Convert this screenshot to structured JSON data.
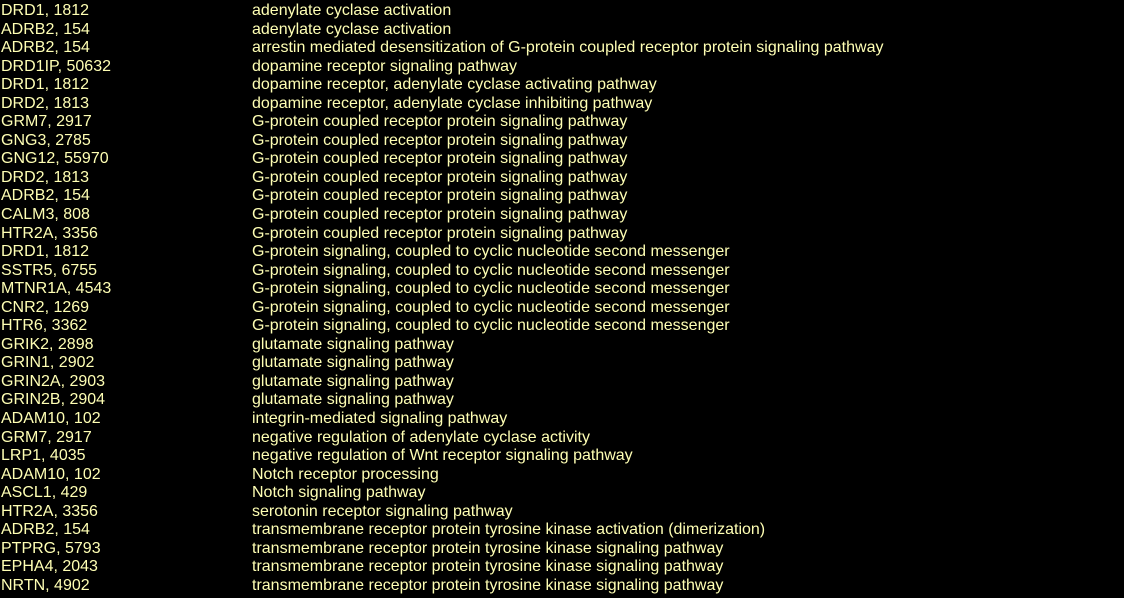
{
  "text_color": "#ffffb4",
  "rows": [
    {
      "gene": "DRD1, 1812",
      "term": "adenylate cyclase activation"
    },
    {
      "gene": "ADRB2, 154",
      "term": "adenylate cyclase activation"
    },
    {
      "gene": "ADRB2, 154",
      "term": "arrestin mediated desensitization of G-protein coupled receptor protein signaling pathway"
    },
    {
      "gene": "DRD1IP, 50632",
      "term": "dopamine receptor signaling pathway"
    },
    {
      "gene": "DRD1, 1812",
      "term": "dopamine receptor, adenylate cyclase activating pathway"
    },
    {
      "gene": "DRD2, 1813",
      "term": "dopamine receptor, adenylate cyclase inhibiting pathway"
    },
    {
      "gene": "GRM7, 2917",
      "term": "G-protein coupled receptor protein signaling pathway"
    },
    {
      "gene": "GNG3, 2785",
      "term": "G-protein coupled receptor protein signaling pathway"
    },
    {
      "gene": "GNG12, 55970",
      "term": "G-protein coupled receptor protein signaling pathway"
    },
    {
      "gene": "DRD2, 1813",
      "term": "G-protein coupled receptor protein signaling pathway"
    },
    {
      "gene": "ADRB2, 154",
      "term": "G-protein coupled receptor protein signaling pathway"
    },
    {
      "gene": "CALM3, 808",
      "term": "G-protein coupled receptor protein signaling pathway"
    },
    {
      "gene": "HTR2A, 3356",
      "term": "G-protein coupled receptor protein signaling pathway"
    },
    {
      "gene": "DRD1, 1812",
      "term": "G-protein signaling, coupled to cyclic nucleotide second messenger"
    },
    {
      "gene": "SSTR5, 6755",
      "term": "G-protein signaling, coupled to cyclic nucleotide second messenger"
    },
    {
      "gene": "MTNR1A, 4543",
      "term": "G-protein signaling, coupled to cyclic nucleotide second messenger"
    },
    {
      "gene": "CNR2, 1269",
      "term": "G-protein signaling, coupled to cyclic nucleotide second messenger"
    },
    {
      "gene": "HTR6, 3362",
      "term": "G-protein signaling, coupled to cyclic nucleotide second messenger"
    },
    {
      "gene": "GRIK2, 2898",
      "term": "glutamate signaling pathway"
    },
    {
      "gene": "GRIN1, 2902",
      "term": "glutamate signaling pathway"
    },
    {
      "gene": "GRIN2A, 2903",
      "term": "glutamate signaling pathway"
    },
    {
      "gene": "GRIN2B, 2904",
      "term": "glutamate signaling pathway"
    },
    {
      "gene": "ADAM10, 102",
      "term": "integrin-mediated signaling pathway"
    },
    {
      "gene": "GRM7, 2917",
      "term": "negative regulation of adenylate cyclase activity"
    },
    {
      "gene": "LRP1, 4035",
      "term": "negative regulation of Wnt receptor signaling pathway"
    },
    {
      "gene": "ADAM10, 102",
      "term": "Notch receptor processing"
    },
    {
      "gene": "ASCL1, 429",
      "term": "Notch signaling pathway"
    },
    {
      "gene": "HTR2A, 3356",
      "term": "serotonin receptor signaling pathway"
    },
    {
      "gene": "ADRB2, 154",
      "term": "transmembrane receptor protein tyrosine kinase activation (dimerization)"
    },
    {
      "gene": "PTPRG, 5793",
      "term": "transmembrane receptor protein tyrosine kinase signaling pathway"
    },
    {
      "gene": "EPHA4, 2043",
      "term": "transmembrane receptor protein tyrosine kinase signaling pathway"
    },
    {
      "gene": "NRTN, 4902",
      "term": "transmembrane receptor protein tyrosine kinase signaling pathway"
    }
  ]
}
